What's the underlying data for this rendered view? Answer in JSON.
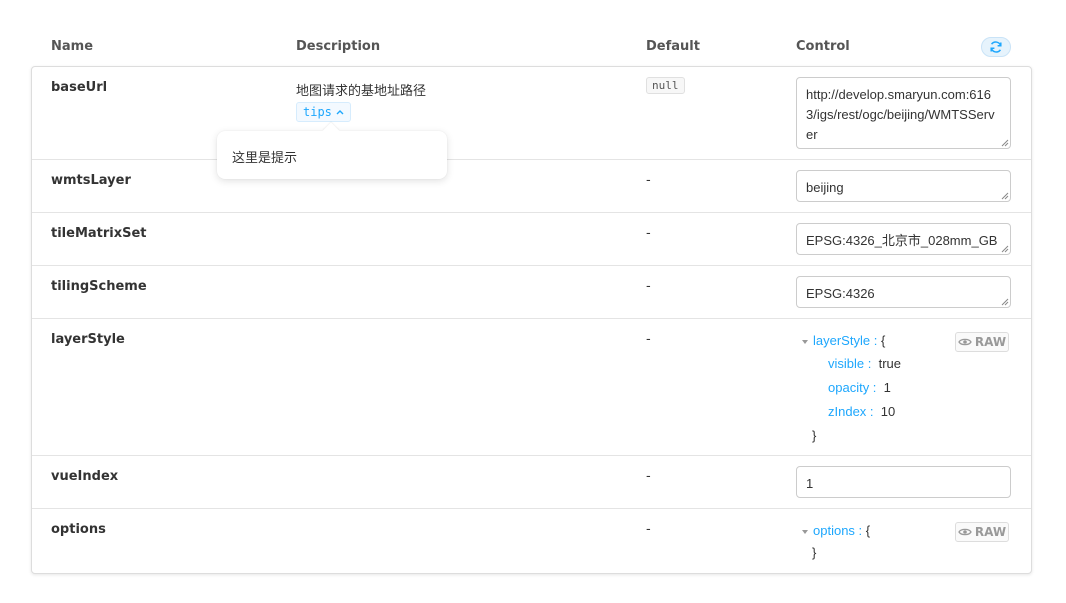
{
  "header": {
    "name": "Name",
    "description": "Description",
    "default": "Default",
    "control": "Control"
  },
  "popover": {
    "text": "这里是提示"
  },
  "rows": {
    "baseUrl": {
      "name": "baseUrl",
      "description": "地图请求的基地址路径",
      "tips_label": "tips",
      "default": "null",
      "value": "http://develop.smaryun.com:6163/igs/rest/ogc/beijing/WMTSServer"
    },
    "wmtsLayer": {
      "name": "wmtsLayer",
      "default": "-",
      "value": "beijing"
    },
    "tileMatrixSet": {
      "name": "tileMatrixSet",
      "default": "-",
      "value": "EPSG:4326_北京市_028mm_GB"
    },
    "tilingScheme": {
      "name": "tilingScheme",
      "default": "-",
      "value": "EPSG:4326"
    },
    "layerStyle": {
      "name": "layerStyle",
      "default": "-",
      "root_key": "layerStyle :",
      "open_brace": "{",
      "close_brace": "}",
      "entries": [
        {
          "key": "visible :",
          "value": "true"
        },
        {
          "key": "opacity :",
          "value": "1"
        },
        {
          "key": "zIndex :",
          "value": "10"
        }
      ],
      "raw_label": "RAW"
    },
    "vueIndex": {
      "name": "vueIndex",
      "default": "-",
      "value": "1"
    },
    "options": {
      "name": "options",
      "default": "-",
      "root_key": "options :",
      "open_brace": "{",
      "close_brace": "}",
      "raw_label": "RAW"
    }
  },
  "icons": {
    "refresh": "refresh-icon",
    "chevron": "chevron-up-icon",
    "eye": "eye-icon"
  },
  "colors": {
    "accent": "#1ea7fd",
    "border": "#dddddd"
  }
}
